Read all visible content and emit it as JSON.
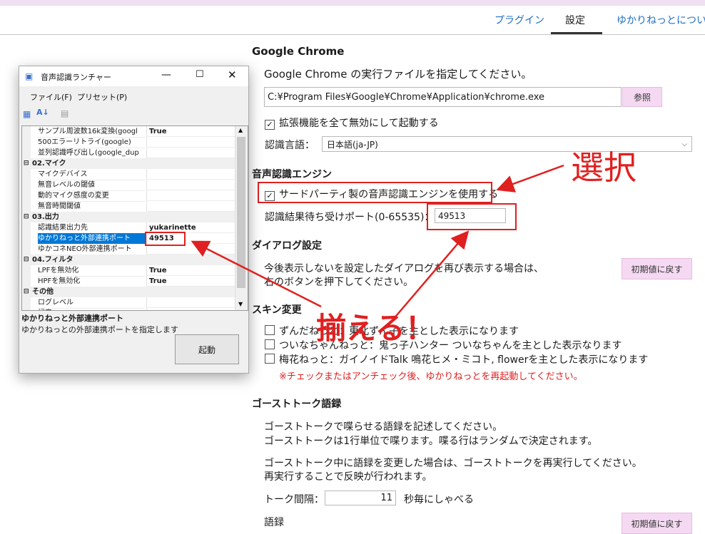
{
  "tabs": [
    {
      "label": "プラグイン"
    },
    {
      "label": "設定"
    },
    {
      "label": "ゆかりねっとについて"
    }
  ],
  "chrome": {
    "heading": "Google Chrome",
    "desc": "Google Chrome の実行ファイルを指定してください。",
    "path_value": "C:¥Program Files¥Google¥Chrome¥Application¥chrome.exe",
    "browse_label": "参照",
    "disable_ext_label": "拡張機能を全て無効にして起動する",
    "lang_label": "認識言語：",
    "lang_value": "日本語(ja-JP)"
  },
  "engine": {
    "heading": "音声認識エンジン",
    "third_party_label": "サードパーティ製の音声認識エンジンを使用する",
    "port_label": "認識結果待ち受けポート(0-65535)：",
    "port_value": "49513"
  },
  "dialog_settings": {
    "heading": "ダイアログ設定",
    "desc_line1": "今後表示しないを設定したダイアログを再び表示する場合は、",
    "desc_line2": "右のボタンを押下してください。",
    "reset_label": "初期値に戻す"
  },
  "skin": {
    "heading": "スキン変更",
    "option1": "ずんだねっと：東北ずん子を主とした表示になります",
    "option2": "ついなちゃんねっと：鬼っ子ハンター ついなちゃんを主とした表示なります",
    "option3": "梅花ねっと：ガイノイドTalk 鳴花ヒメ・ミコト, flowerを主とした表示になります",
    "warning": "※チェックまたはアンチェック後、ゆかりねっとを再起動してください。"
  },
  "ghost": {
    "heading": "ゴーストトーク語録",
    "p1_line1": "ゴーストトークで喋らせる語録を記述してください。",
    "p1_line2": "ゴーストトークは1行単位で喋ります。喋る行はランダムで決定されます。",
    "p2_line1": "ゴーストトーク中に語録を変更した場合は、ゴーストトークを再実行してください。",
    "p2_line2": "再実行することで反映が行われます。",
    "interval_label": "トーク間隔：",
    "interval_value": "11",
    "interval_unit": "秒毎にしゃべる",
    "bottom_label": "語録",
    "bottom_reset": "初期値に戻す"
  },
  "annotations": {
    "select": "選択",
    "align": "揃える！",
    "color": "#e02020"
  },
  "launcher": {
    "title": "音声認識ランチャー",
    "menu_file": "ファイル(F)",
    "menu_preset": "プリセット(P)",
    "rows": [
      {
        "kind": "prop",
        "name": "サンプル周波数16k変換(googl",
        "value": "True"
      },
      {
        "kind": "prop",
        "name": "500エラーリトライ(google)",
        "value": ""
      },
      {
        "kind": "prop",
        "name": "並列認識呼び出し(google_dup",
        "value": ""
      },
      {
        "kind": "cat",
        "name": "02.マイク"
      },
      {
        "kind": "prop",
        "name": "マイクデバイス",
        "value": ""
      },
      {
        "kind": "prop",
        "name": "無音レベルの閾値",
        "value": ""
      },
      {
        "kind": "prop",
        "name": "動的マイク感度の変更",
        "value": ""
      },
      {
        "kind": "prop",
        "name": "無音時間閾値",
        "value": ""
      },
      {
        "kind": "cat",
        "name": "03.出力"
      },
      {
        "kind": "prop",
        "name": "認識結果出力先",
        "value": "yukarinette"
      },
      {
        "kind": "sel",
        "name": "ゆかりねっと外部連携ポート",
        "value": "49513"
      },
      {
        "kind": "prop",
        "name": "ゆかコネNEO外部連携ポート",
        "value": ""
      },
      {
        "kind": "cat",
        "name": "04.フィルタ"
      },
      {
        "kind": "prop",
        "name": "LPFを無効化",
        "value": "True"
      },
      {
        "kind": "prop",
        "name": "HPFを無効化",
        "value": "True"
      },
      {
        "kind": "cat",
        "name": "その他"
      },
      {
        "kind": "prop",
        "name": "ログレベル",
        "value": ""
      },
      {
        "kind": "prop",
        "name": "緑音",
        "value": ""
      }
    ],
    "desc_title": "ゆかりねっと外部連携ポート",
    "desc_text": "ゆかりねっとの外部連携ポートを指定します",
    "start_label": "起動"
  }
}
